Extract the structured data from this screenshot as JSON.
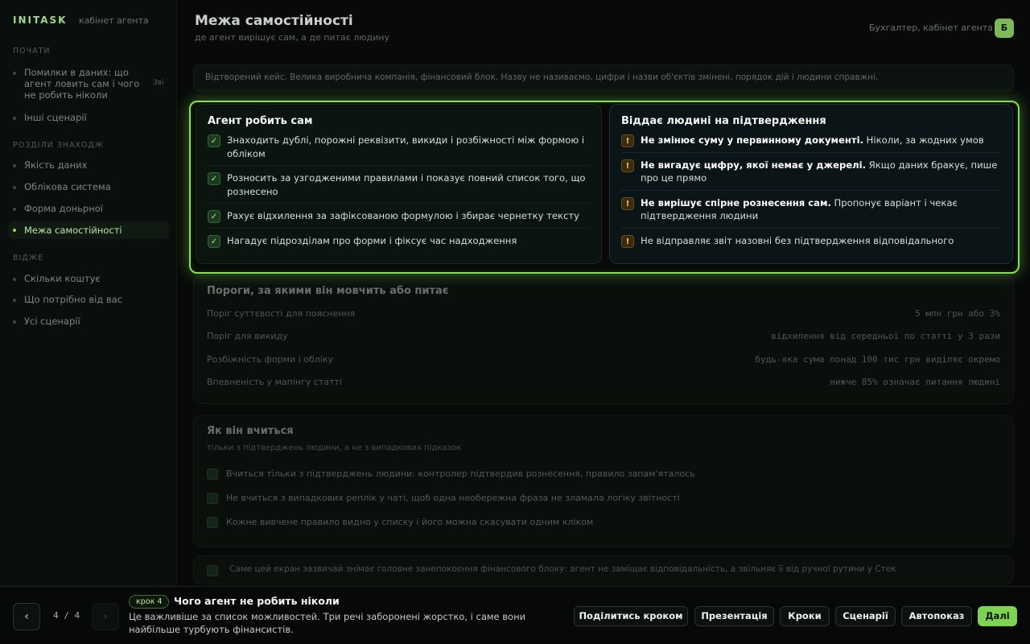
{
  "brand": {
    "name": "INITASK",
    "subtitle": "кабінет агента"
  },
  "sidebar": {
    "sections": [
      {
        "title": "ПОЧАТИ"
      },
      {
        "title": "РОЗДІЛИ ЗНАХОДЖ"
      },
      {
        "title": "ВІДЖЕ"
      }
    ],
    "start_items": [
      {
        "label": "Помилки в даних: що агент ловить сам і чого не робить ніколи",
        "badge": "Зві"
      },
      {
        "label": "Інші сценарії"
      }
    ],
    "section_items": [
      {
        "label": "Якість даних"
      },
      {
        "label": "Обліковa система"
      },
      {
        "label": "Форма доньрної"
      },
      {
        "label": "Межа самостійності"
      }
    ],
    "widget_items": [
      {
        "label": "Скільки коштує"
      },
      {
        "label": "Що потрібно від вас"
      },
      {
        "label": "Усі сценарії"
      }
    ]
  },
  "header": {
    "title": "Межа самостійності",
    "subtitle": "де агент вирішує сам, а де питає людину",
    "user_text": "Бухгалтер, кабінет агента",
    "avatar": "Б"
  },
  "note": "Відтворений кейс. Велика виробнича компанія, фінансовий блок. Назву не називаємо, цифри і назви об'єктів змінені, порядок дій і людини справжні.",
  "left_column": {
    "title": "Агент робить сам",
    "items": [
      {
        "text": "Знаходить дублі, порожні реквізити, викиди і розбіжності між формою і обліком"
      },
      {
        "text": "Розносить за узгодженими правилами і показує повний список того, що рознесено"
      },
      {
        "text": "Рахує відхилення за зафіксованою формулою і збирає чернетку тексту"
      },
      {
        "text": "Нагадує підрозділам про форми і фіксує час надходження"
      }
    ]
  },
  "right_column": {
    "title": "Віддає людині на підтвердження",
    "items": [
      {
        "bold": "Не змінює суму у первинному документі.",
        "text": " Ніколи, за жодних умов"
      },
      {
        "bold": "Не вигадує цифру, якої немає у джерелі.",
        "text": " Якщо даних бракує, пише про це прямо"
      },
      {
        "bold": "Не вирішує спірне рознесення сам.",
        "text": " Пропонує варіант і чекає підтвердження людини"
      },
      {
        "bold": "",
        "text": "Не відправляє звіт назовні без підтвердження відповідального"
      }
    ]
  },
  "thresholds": {
    "title": "Пороги, за якими він мовчить або питає",
    "rows": [
      {
        "label": "Поріг суттєвості для пояснення",
        "value": "5 млн грн або 3%"
      },
      {
        "label": "Поріг для викиду",
        "value": "відхилення від середньої по статті у 3 рази"
      },
      {
        "label": "Розбіжність форми і обліку",
        "value": "будь-яка сума понад 100 тис грн виділяє окремо"
      },
      {
        "label": "Впевненість у мапінгу статті",
        "value": "нижче 85% означає питання людині"
      }
    ]
  },
  "learning": {
    "title": "Як він вчиться",
    "subtitle": "тільки з підтверджень людини, а не з випадкових підказок",
    "items": [
      {
        "text": "Вчиться тільки з підтверджень людини: контролер підтвердив рознесення, правило запам'яталось"
      },
      {
        "text": "Не вчиться з випадкових реплік у чаті, щоб одна необережна фраза не зламала логіку звітності"
      },
      {
        "text": "Кожне вивчене правило видно у списку і його можна скасувати одним кліком"
      }
    ]
  },
  "footer_note": "Саме цей екран зазвичай знімає головне занепокоєння фінансового блоку: агент не заміщає відповідальність, а звільняє її від ручної рутини у Стек",
  "bottom": {
    "prev": "‹",
    "next": "›",
    "counter": "4 / 4",
    "step_badge": "крок 4",
    "step_title": "Чого агент не робить ніколи",
    "step_desc": "Це важливіше за список можливостей. Три речі заборонені жорстко, і саме вони найбільше турбують фінансистів.",
    "buttons": {
      "share": "Поділитись кроком",
      "presentation": "Презентація",
      "steps": "Кроки",
      "scenarios": "Сценарії",
      "autoplay": "Автопоказ",
      "next": "Далі"
    }
  },
  "colors": {
    "accent": "#86e04d",
    "warn": "#f0c35a",
    "background": "#070a09"
  }
}
